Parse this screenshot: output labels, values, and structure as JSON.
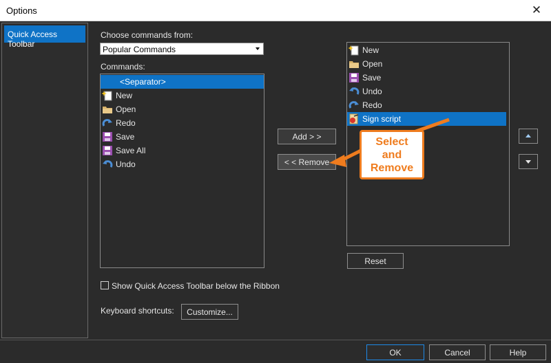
{
  "window": {
    "title": "Options"
  },
  "nav": {
    "items": [
      {
        "label": "Quick Access Toolbar"
      }
    ]
  },
  "commands_from": {
    "label": "Choose commands from:",
    "value": "Popular Commands"
  },
  "commands": {
    "label": "Commands:",
    "items": [
      {
        "label": "<Separator>",
        "icon": "none"
      },
      {
        "label": "New",
        "icon": "new-doc-icon"
      },
      {
        "label": "Open",
        "icon": "folder-icon"
      },
      {
        "label": "Redo",
        "icon": "redo-icon"
      },
      {
        "label": "Save",
        "icon": "save-icon"
      },
      {
        "label": "Save All",
        "icon": "save-all-icon"
      },
      {
        "label": "Undo",
        "icon": "undo-icon"
      }
    ]
  },
  "toolbar_list": {
    "items": [
      {
        "label": "New",
        "icon": "new-doc-icon"
      },
      {
        "label": "Open",
        "icon": "folder-icon"
      },
      {
        "label": "Save",
        "icon": "save-icon"
      },
      {
        "label": "Undo",
        "icon": "undo-icon"
      },
      {
        "label": "Redo",
        "icon": "redo-icon"
      },
      {
        "label": "Sign script",
        "icon": "sign-script-icon"
      }
    ]
  },
  "buttons": {
    "add": "Add > >",
    "remove": "< < Remove",
    "reset": "Reset",
    "customize": "Customize..."
  },
  "checkbox": {
    "label": "Show Quick Access Toolbar below the Ribbon",
    "checked": false
  },
  "keyboard": {
    "label": "Keyboard shortcuts:"
  },
  "callout": {
    "line1": "Select",
    "line2": "and",
    "line3": "Remove"
  },
  "footer": {
    "ok": "OK",
    "cancel": "Cancel",
    "help": "Help"
  },
  "colors": {
    "selection": "#0f73c6",
    "callout": "#ef7c1e",
    "background": "#2b2b2b"
  }
}
